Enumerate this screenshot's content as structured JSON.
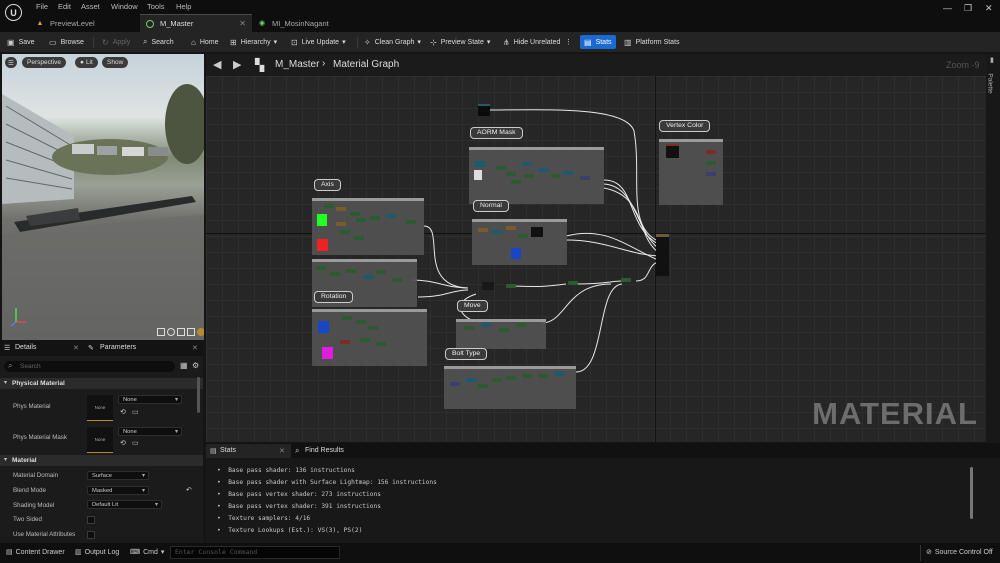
{
  "menu": [
    "File",
    "Edit",
    "Asset",
    "Window",
    "Tools",
    "Help"
  ],
  "tabs": [
    {
      "label": "PreviewLevel",
      "icon": "level-icon"
    },
    {
      "label": "M_Master",
      "icon": "material-icon"
    },
    {
      "label": "MI_MosinNagant",
      "icon": "material-instance-icon"
    }
  ],
  "toolbar": {
    "save": "Save",
    "browse": "Browse",
    "apply": "Apply",
    "search": "Search",
    "home": "Home",
    "hierarchy": "Hierarchy",
    "live_update": "Live Update",
    "clean_graph": "Clean Graph",
    "preview_state": "Preview State",
    "hide_unrelated": "Hide Unrelated",
    "stats": "Stats",
    "platform_stats": "Platform Stats"
  },
  "viewport": {
    "perspective": "Perspective",
    "lit": "Lit",
    "show": "Show"
  },
  "details": {
    "tab_details": "Details",
    "tab_parameters": "Parameters",
    "search_placeholder": "Search",
    "cat_physical": "Physical Material",
    "phys_material": "Phys Material",
    "phys_material_value": "None",
    "phys_material_thumb": "None",
    "phys_material_mask": "Phys Material Mask",
    "phys_material_mask_value": "None",
    "phys_material_mask_thumb": "None",
    "cat_material": "Material",
    "material_domain": "Material Domain",
    "material_domain_value": "Surface",
    "blend_mode": "Blend Mode",
    "blend_mode_value": "Masked",
    "shading_model": "Shading Model",
    "shading_model_value": "Default Lit",
    "two_sided": "Two Sided",
    "use_material_attributes": "Use Material Attributes"
  },
  "graph": {
    "breadcrumb_root": "M_Master",
    "breadcrumb_leaf": "Material Graph",
    "zoom": "Zoom -9",
    "palette": "Palette",
    "watermark": "MATERIAL",
    "comments": [
      "AORM Mask",
      "Vertex Color",
      "Axis",
      "Normal",
      "Rotation",
      "Move",
      "Bolt Type"
    ]
  },
  "stats": {
    "tab_stats": "Stats",
    "tab_find": "Find Results",
    "lines": [
      "Base pass shader: 136 instructions",
      "Base pass shader with Surface Lightmap: 156 instructions",
      "Base pass vertex shader: 273 instructions",
      "Base pass vertex shader: 391 instructions",
      "Texture samplers: 4/16",
      "Texture Lookups (Est.): VS(3), PS(2)"
    ]
  },
  "bottom": {
    "content_drawer": "Content Drawer",
    "output_log": "Output Log",
    "cmd": "Cmd",
    "console_placeholder": "Enter Console Command",
    "source_control": "Source Control Off"
  }
}
